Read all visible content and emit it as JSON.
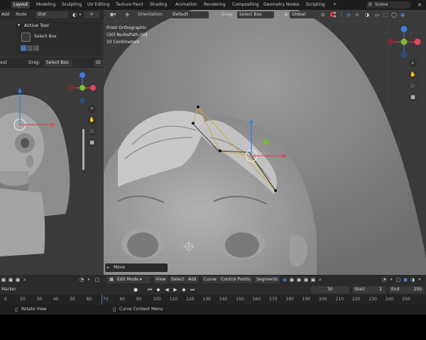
{
  "top_tabs": [
    "Layout",
    "Modeling",
    "Sculpting",
    "UV Editing",
    "Texture Paint",
    "Shading",
    "Animation",
    "Rendering",
    "Compositing",
    "Geometry Nodes",
    "Scripting"
  ],
  "scene_field": "Scene",
  "left_top_header": {
    "add": "Add",
    "node": "Node",
    "slot": "Slot"
  },
  "active_tool": {
    "title": "Active Tool",
    "tool": "Select Box"
  },
  "main_header": {
    "orientation_label": "Orientation:",
    "orientation_value": "Default",
    "drag_label": "Drag:",
    "drag_value": "Select Box",
    "transform": "Global"
  },
  "left_viewport_header": {
    "drag_label": "Drag:",
    "drag_value": "Select Box",
    "partial_left": "out",
    "partial_right": "Gl"
  },
  "viewport_info": {
    "line1": "Front Orthographic",
    "line2": "(30) NurbsPath.001",
    "line3": "10 Centimeters"
  },
  "operator_panel": "Move",
  "bottom_header": {
    "mode": "Edit Mode",
    "menus": [
      "View",
      "Select",
      "Add",
      "Curve",
      "Control Points",
      "Segments"
    ]
  },
  "timeline": {
    "marker": "Marker",
    "current_frame": "30",
    "start_label": "Start",
    "start_value": "1",
    "end_label": "End",
    "end_value": "250"
  },
  "ruler_ticks": [
    "0",
    "20",
    "30",
    "40",
    "50",
    "60",
    "70",
    "80",
    "90",
    "100",
    "110",
    "120",
    "130",
    "140",
    "150",
    "160",
    "170",
    "180",
    "190",
    "200",
    "210",
    "220",
    "230",
    "240",
    "250"
  ],
  "status_bar": {
    "left": "Rotate View",
    "right": "Curve Context Menu"
  },
  "colors": {
    "accent": "#4772b3",
    "gizmo_x": "#e0475a",
    "gizmo_y": "#7dbb2e",
    "gizmo_z": "#3b7de0",
    "curve": "#c9a44a"
  }
}
